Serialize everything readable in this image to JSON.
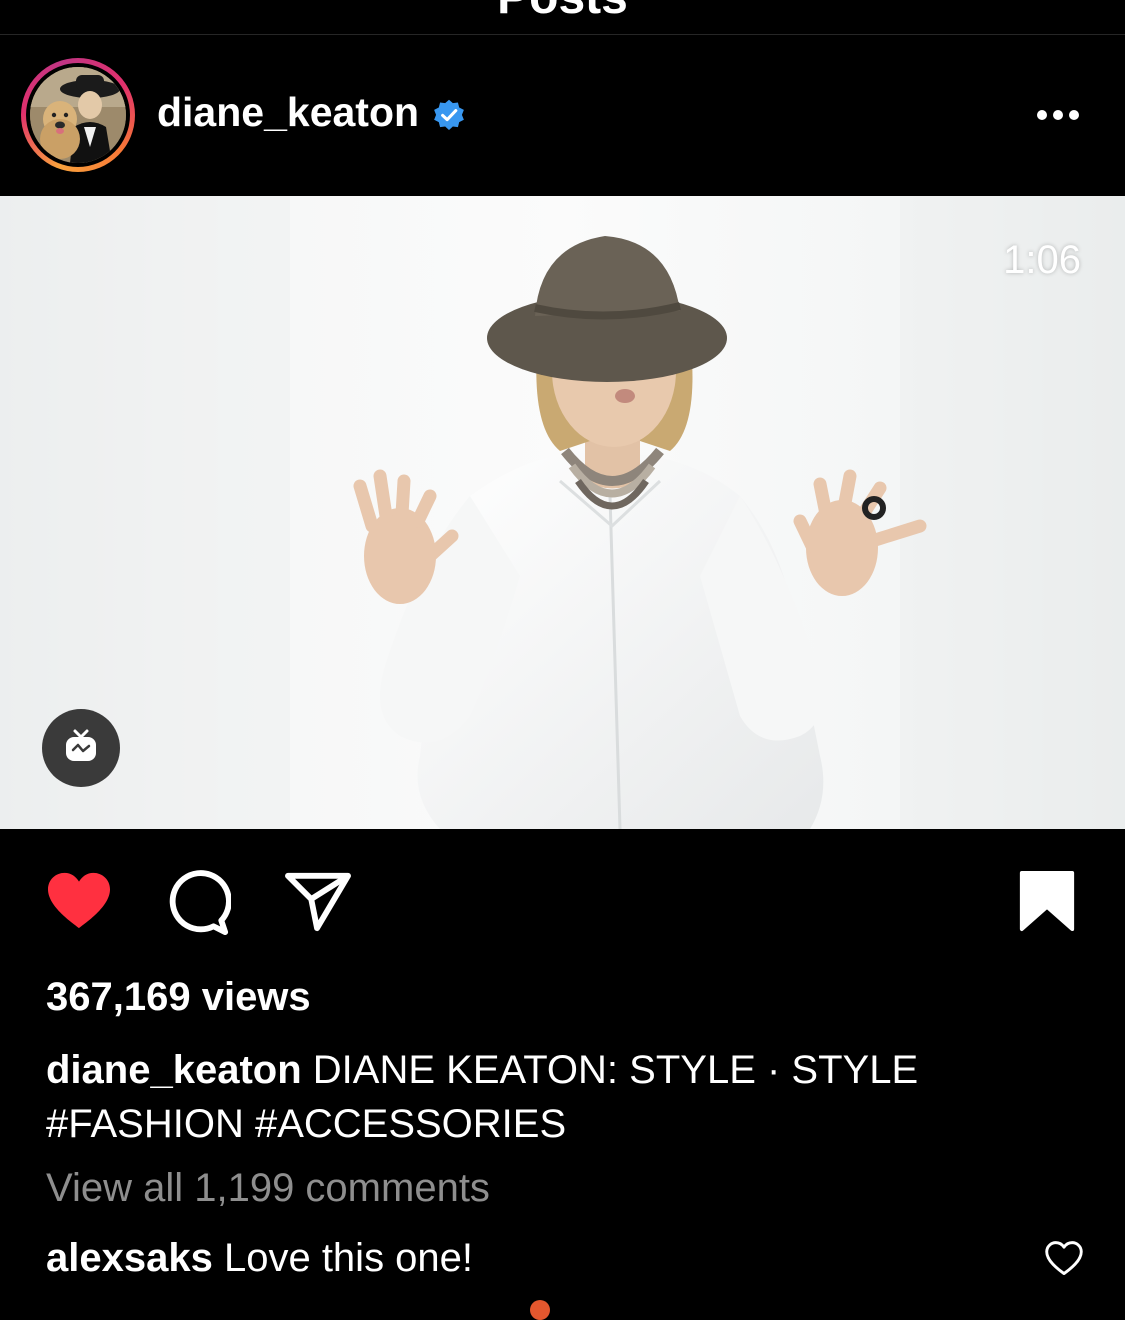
{
  "topbar": {
    "title": "Posts"
  },
  "post": {
    "username": "diane_keaton",
    "verified": true,
    "duration": "1:06",
    "views": "367,169 views",
    "caption": {
      "username": "diane_keaton",
      "line1": "DIANE KEATON: STYLE · STYLE",
      "line2": "#FASHION #ACCESSORIES"
    },
    "view_all_comments": "View all 1,199 comments",
    "comment": {
      "username": "alexsaks",
      "text": "Love this one!"
    },
    "liked": true,
    "saved": true
  },
  "colors": {
    "like": "#ff3040",
    "verified": "#3897f0",
    "muted_text": "#8e8e8e",
    "background": "#000000"
  },
  "icons": {
    "more": "more-horizontal-icon",
    "like": "heart-filled-icon",
    "comment": "comment-bubble-icon",
    "share": "paper-plane-icon",
    "save": "bookmark-filled-icon",
    "igtv": "igtv-icon",
    "comment_like": "heart-outline-icon"
  }
}
